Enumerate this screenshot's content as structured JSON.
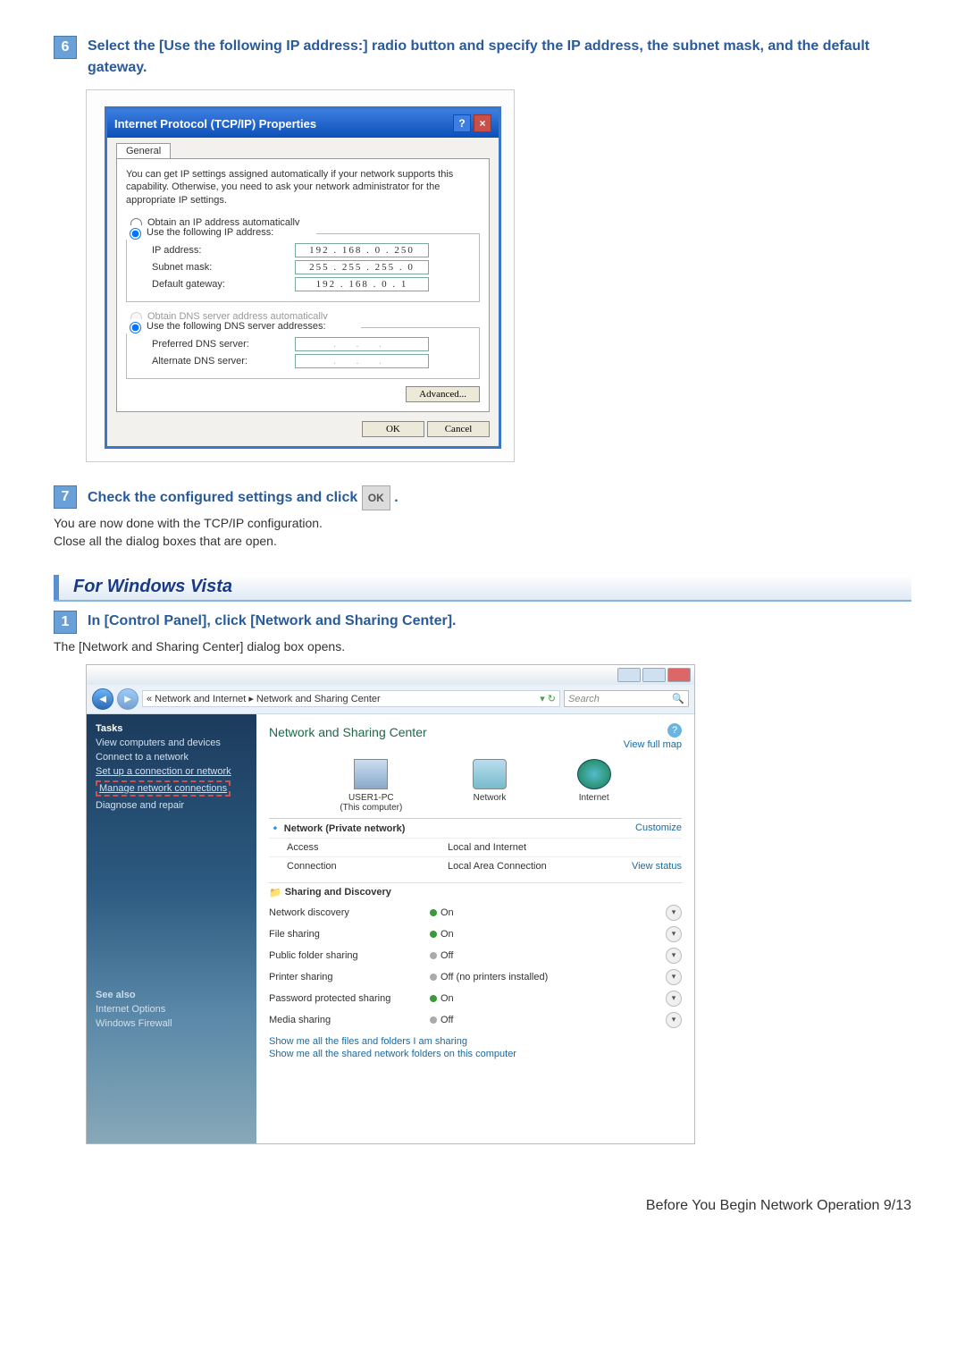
{
  "step6": {
    "num": "6",
    "text": "Select the [Use the following IP address:] radio button and specify the IP address, the subnet mask, and the default gateway."
  },
  "dialog": {
    "title": "Internet Protocol (TCP/IP) Properties",
    "tab": "General",
    "intro": "You can get IP settings assigned automatically if your network supports this capability. Otherwise, you need to ask your network administrator for the appropriate IP settings.",
    "radio_auto_ip": "Obtain an IP address automatically",
    "radio_use_ip": "Use the following IP address:",
    "field_ip": "IP address:",
    "val_ip": "192 . 168 .  0 . 250",
    "field_mask": "Subnet mask:",
    "val_mask": "255 . 255 . 255 .  0",
    "field_gw": "Default gateway:",
    "val_gw": "192 . 168 .  0 .  1",
    "radio_auto_dns": "Obtain DNS server address automatically",
    "radio_use_dns": "Use the following DNS server addresses:",
    "field_pref_dns": "Preferred DNS server:",
    "field_alt_dns": "Alternate DNS server:",
    "empty_ip": ".   .   .",
    "advanced": "Advanced...",
    "ok": "OK",
    "cancel": "Cancel"
  },
  "step7": {
    "num": "7",
    "text_before": "Check the configured settings and click ",
    "btn": "OK",
    "text_after": "."
  },
  "after7": {
    "line1": "You are now done with the TCP/IP configuration.",
    "line2": "Close all the dialog boxes that are open."
  },
  "vista_heading": "For Windows Vista",
  "step1": {
    "num": "1",
    "text": "In [Control Panel], click [Network and Sharing Center]."
  },
  "after1": "The [Network and Sharing Center] dialog box opens.",
  "vista": {
    "breadcrumb": "« Network and Internet  ▸  Network and Sharing Center",
    "search_placeholder": "Search",
    "tasks_title": "Tasks",
    "links": {
      "view_comp": "View computers and devices",
      "connect": "Connect to a network",
      "setup": "Set up a connection or network",
      "manage": "Manage network connections",
      "diagnose": "Diagnose and repair"
    },
    "seealso_title": "See also",
    "seealso_links": {
      "io": "Internet Options",
      "wf": "Windows Firewall"
    },
    "main_title": "Network and Sharing Center",
    "view_map": "View full map",
    "pc": "USER1-PC",
    "pc_sub": "(This computer)",
    "network": "Network",
    "internet": "Internet",
    "net_name": "Network (Private network)",
    "customize": "Customize",
    "access_l": "Access",
    "access_v": "Local and Internet",
    "conn_l": "Connection",
    "conn_v": "Local Area Connection",
    "view_status": "View status",
    "sharing_title": "Sharing and Discovery",
    "rows": {
      "nd_l": "Network discovery",
      "nd_v": "On",
      "fs_l": "File sharing",
      "fs_v": "On",
      "pf_l": "Public folder sharing",
      "pf_v": "Off",
      "ps_l": "Printer sharing",
      "ps_v": "Off (no printers installed)",
      "pw_l": "Password protected sharing",
      "pw_v": "On",
      "ms_l": "Media sharing",
      "ms_v": "Off"
    },
    "bottom_link1": "Show me all the files and folders I am sharing",
    "bottom_link2": "Show me all the shared network folders on this computer"
  },
  "footer": "Before You Begin Network Operation 9/13"
}
